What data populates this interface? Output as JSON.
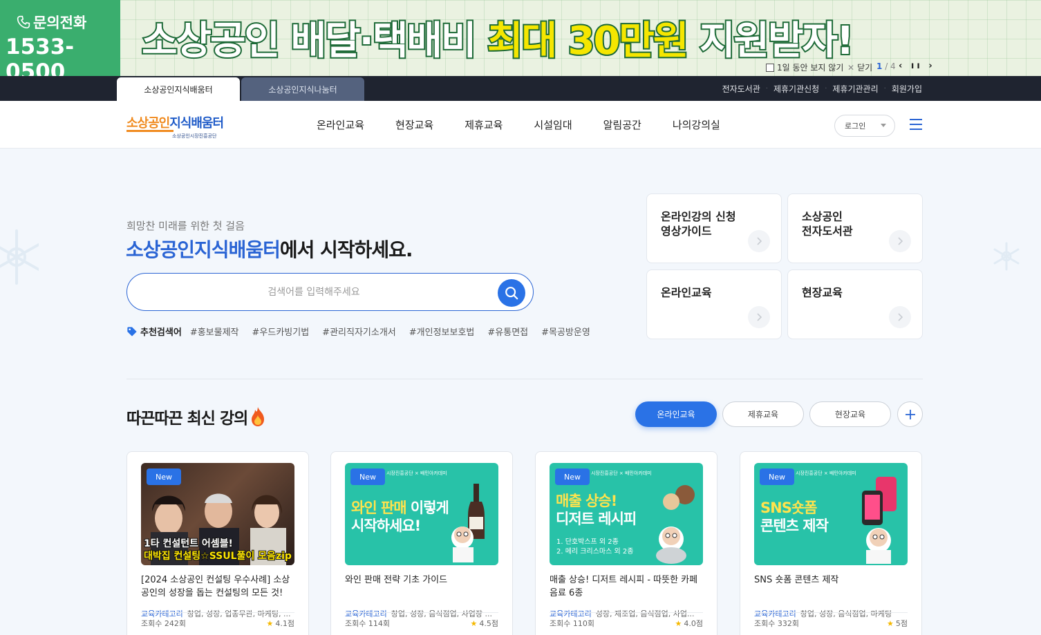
{
  "banner": {
    "phone_label": "문의전화",
    "phone_number": "1533-0500",
    "headline_prefix": "소상공인 배달·택배비 ",
    "headline_highlight": "최대 30만원",
    "headline_suffix": " 지원받자!",
    "hide_today": "1일 동안 보지 않기",
    "close": "닫기",
    "page_current": "1",
    "page_total": "/ 4",
    "controls": "‹ ıı ›",
    "bg_color": "#eaf2e1",
    "phone_bg": "#3aae6e"
  },
  "site_tabs": [
    {
      "label": "소상공인지식배움터",
      "active": true
    },
    {
      "label": "소상공인지식나눔터",
      "active": false
    }
  ],
  "util_links": [
    "전자도서관",
    "제휴기관신청",
    "제휴기관관리",
    "회원가입"
  ],
  "header": {
    "logo_orange": "소상공인",
    "logo_blue": "지식배움터",
    "logo_sub": "소상공인시장진흥공단",
    "nav": [
      "온라인교육",
      "현장교육",
      "제휴교육",
      "시설임대",
      "알림공간",
      "나의강의실"
    ],
    "login": "로그인",
    "menu_icon": "hamburger-icon"
  },
  "hero": {
    "subtitle": "희망찬 미래를 위한 첫 걸음",
    "title_accent": "소상공인지식배움터",
    "title_rest": "에서 시작하세요.",
    "search_placeholder": "검색어를 입력해주세요",
    "keywords_label": "추천검색어",
    "keywords": [
      "#홍보물제작",
      "#우드카빙기법",
      "#관리직자기소개서",
      "#개인정보보호법",
      "#유통면접",
      "#목공방운영"
    ]
  },
  "quick_links": [
    {
      "title": "온라인강의 신청\n영상가이드"
    },
    {
      "title": "소상공인\n전자도서관"
    },
    {
      "title": "온라인교육"
    },
    {
      "title": "현장교육"
    }
  ],
  "latest": {
    "title": "따끈따끈 최신 강의",
    "filters": [
      "온라인교육",
      "제휴교육",
      "현장교육"
    ],
    "active_filter": 0
  },
  "cards": [
    {
      "badge": "New",
      "thumb_type": "photo",
      "thumb_caption_1": "1타 컨설턴트 어셈블!",
      "thumb_caption_2": "대박집 컨설팅☆SSUL풀이 모음zip",
      "title": "[2024 소상공인 컨설팅 우수사례] 소상공인의 성장을 돕는 컨설팅의 모든 것! 소...",
      "cat_label": "교육카테고리",
      "cats": "창업, 성장, 업종무관, 마케팅, ...",
      "views": "조회수 242회",
      "rating": "4.1점"
    },
    {
      "badge": "New",
      "thumb_type": "teal",
      "thumb_top": "시장진흥공단 × 배민아카데미",
      "thumb_line1_y": "와인 판매",
      "thumb_line1": " 이렇게",
      "thumb_line2": "시작하세요!",
      "title": "와인 판매 전략 기초 가이드",
      "cat_label": "교육카테고리",
      "cats": "창업, 성장, 음식점업, 사업장 ...",
      "views": "조회수 114회",
      "rating": "4.5점"
    },
    {
      "badge": "New",
      "thumb_type": "teal",
      "thumb_top": "시장진흥공단 × 배민아카데미",
      "thumb_line1_y": "매출 상승!",
      "thumb_line1": "",
      "thumb_line2": "디저트 레시피",
      "thumb_small": "1. 단호박스프 외 2종\n2. 메리 크리스마스 외 2종",
      "title": "매출 상승! 디저트 레시피 - 따뜻한 카페 음료 6종",
      "cat_label": "교육카테고리",
      "cats": "성장, 제조업, 음식점업, 사업...",
      "views": "조회수 110회",
      "rating": "4.0점"
    },
    {
      "badge": "New",
      "thumb_type": "teal",
      "thumb_top": "시장진흥공단 × 배민아카데미",
      "thumb_line1_y": "SNS숏폼",
      "thumb_line1": "",
      "thumb_line2": "콘텐츠 제작",
      "title": "SNS 숏폼 콘텐츠 제작",
      "cat_label": "교육카테고리",
      "cats": "창업, 성장, 음식점업, 마케팅",
      "views": "조회수 332회",
      "rating": "5점"
    }
  ],
  "colors": {
    "primary": "#2a72e6",
    "accent_orange": "#f08a1e",
    "dark_bar": "#1f2430",
    "page_bg": "#f3f7fc"
  }
}
